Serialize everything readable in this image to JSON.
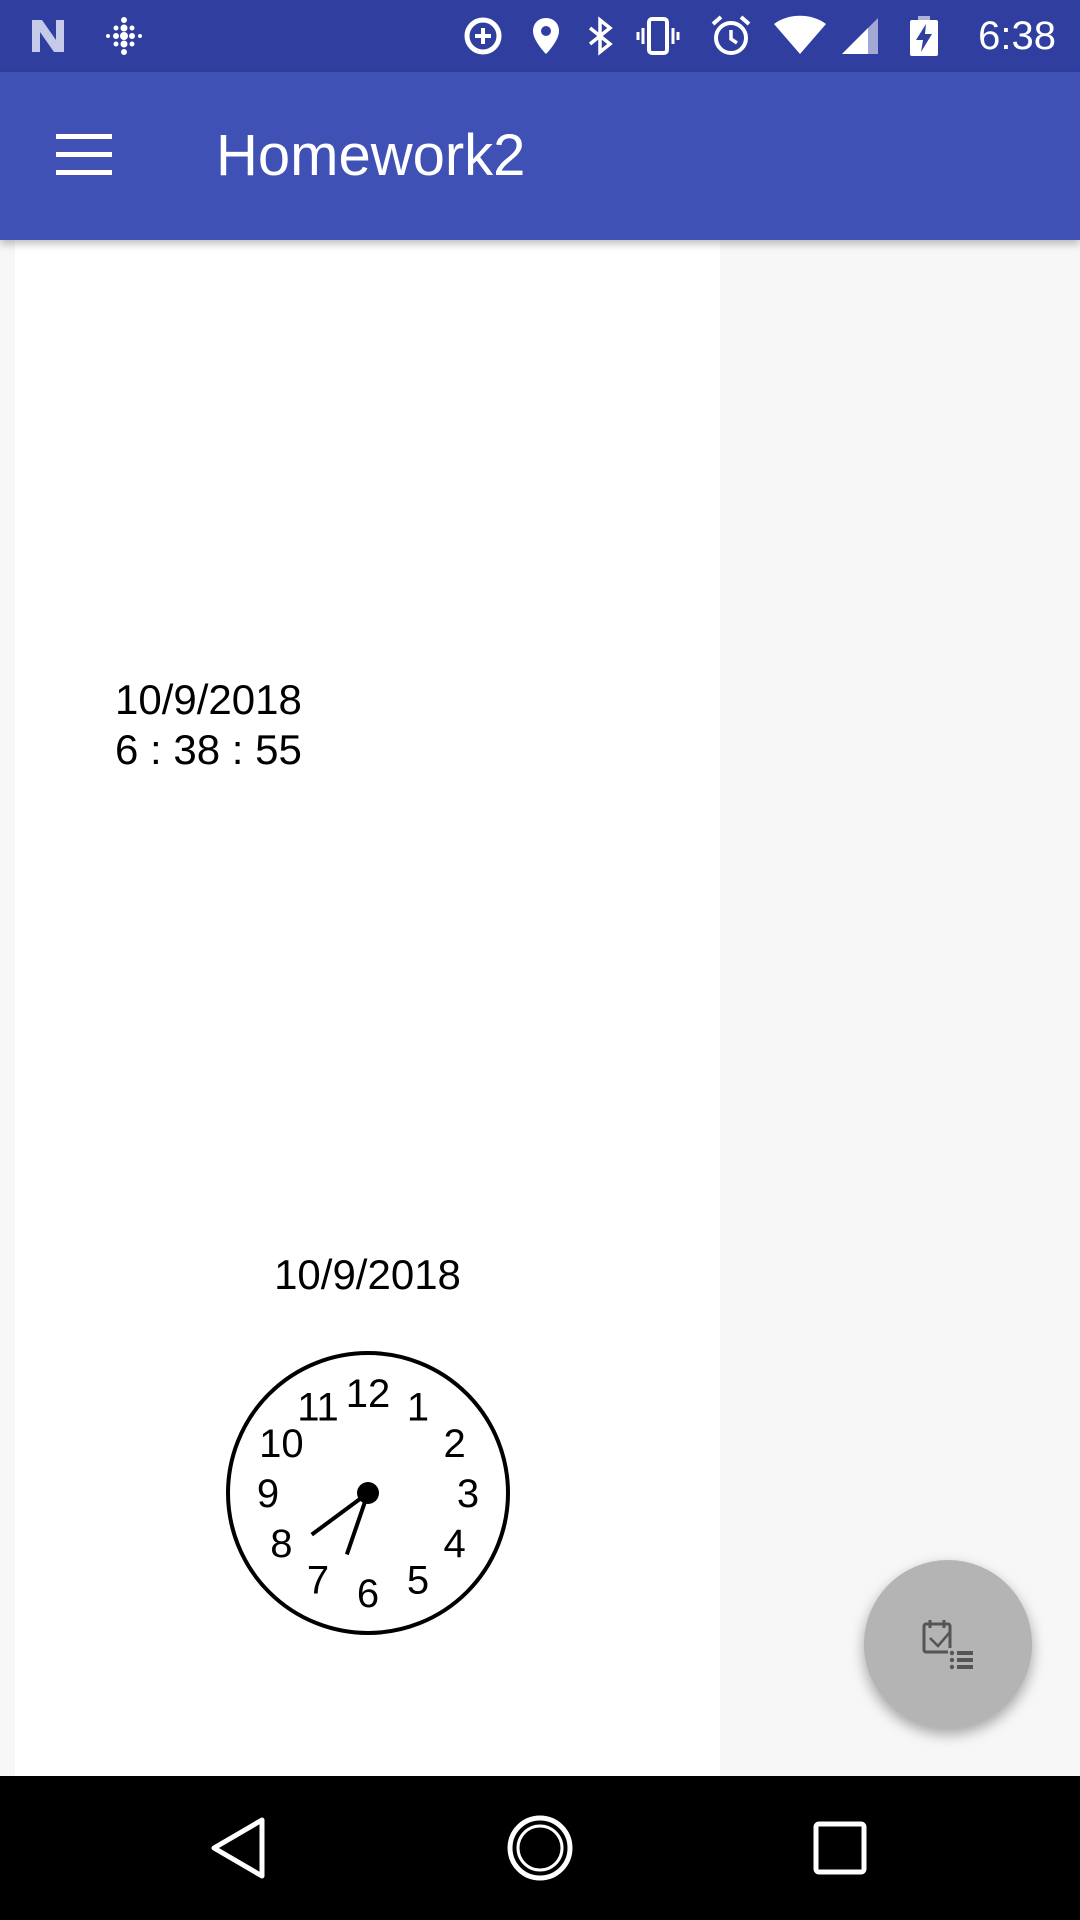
{
  "status_bar": {
    "time": "6:38",
    "icons": [
      "notification-n-icon",
      "fitbit-icon",
      "data-saver-icon",
      "location-icon",
      "bluetooth-icon",
      "vibrate-icon",
      "alarm-icon",
      "wifi-icon",
      "cell-signal-icon",
      "battery-charging-icon"
    ]
  },
  "app_bar": {
    "title": "Homework2",
    "menu_icon": "hamburger-menu-icon"
  },
  "digital_clock": {
    "date": "10/9/2018",
    "time": "6 : 38 : 55"
  },
  "analog_clock": {
    "date": "10/9/2018",
    "numbers": [
      "12",
      "1",
      "2",
      "3",
      "4",
      "5",
      "6",
      "7",
      "8",
      "9",
      "10",
      "11"
    ],
    "hour": 6,
    "minute": 38,
    "second": 55
  },
  "fab": {
    "icon": "notes-list-icon"
  },
  "nav_bar": {
    "icons": [
      "back-icon",
      "home-icon",
      "recents-icon"
    ]
  },
  "colors": {
    "status_bar": "#303f9f",
    "app_bar": "#3f51b5",
    "fab": "#b4b4b4",
    "nav_bar": "#000000"
  }
}
